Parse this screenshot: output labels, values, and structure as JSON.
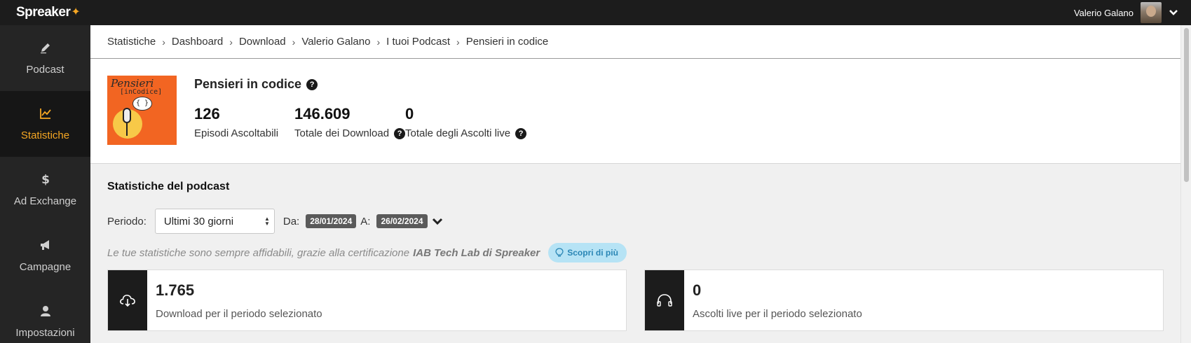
{
  "topbar": {
    "logo": "Spreaker",
    "user_name": "Valerio Galano"
  },
  "sidebar": {
    "items": [
      {
        "label": "Podcast",
        "icon": "pencil-icon",
        "active": false
      },
      {
        "label": "Statistiche",
        "icon": "chart-icon",
        "active": true
      },
      {
        "label": "Ad Exchange",
        "icon": "dollar-icon",
        "active": false
      },
      {
        "label": "Campagne",
        "icon": "megaphone-icon",
        "active": false
      },
      {
        "label": "Impostazioni",
        "icon": "user-icon",
        "active": false
      }
    ]
  },
  "breadcrumb": [
    "Statistiche",
    "Dashboard",
    "Download",
    "Valerio Galano",
    "I tuoi Podcast",
    "Pensieri in codice"
  ],
  "podcast": {
    "cover_title": "Pensieri",
    "cover_subtitle": "[inCodice]",
    "cover_bubble": "{ }",
    "title": "Pensieri in codice",
    "stats": [
      {
        "value": "126",
        "label": "Episodi Ascoltabili"
      },
      {
        "value": "146.609",
        "label": "Totale dei Download"
      },
      {
        "value": "0",
        "label": "Totale degli Ascolti live"
      }
    ]
  },
  "section": {
    "title": "Statistiche del podcast",
    "period_label": "Periodo:",
    "period_value": "Ultimi 30 giorni",
    "from_label": "Da:",
    "from_date": "28/01/2024",
    "to_label": "A:",
    "to_date": "26/02/2024",
    "cert_text": "Le tue statistiche sono sempre affidabili, grazie alla certificazione",
    "cert_bold": "IAB Tech Lab di Spreaker",
    "learn_more": "Scopri di più"
  },
  "cards": [
    {
      "value": "1.765",
      "label": "Download per il periodo selezionato",
      "icon": "cloud-download-icon"
    },
    {
      "value": "0",
      "label": "Ascolti live per il periodo selezionato",
      "icon": "headphones-icon"
    }
  ],
  "colors": {
    "accent": "#f5a623",
    "topbar": "#1c1c1c",
    "sidebar": "#252525",
    "sidebar_active": "#161616",
    "learn_more_bg": "#b6e3f5"
  }
}
